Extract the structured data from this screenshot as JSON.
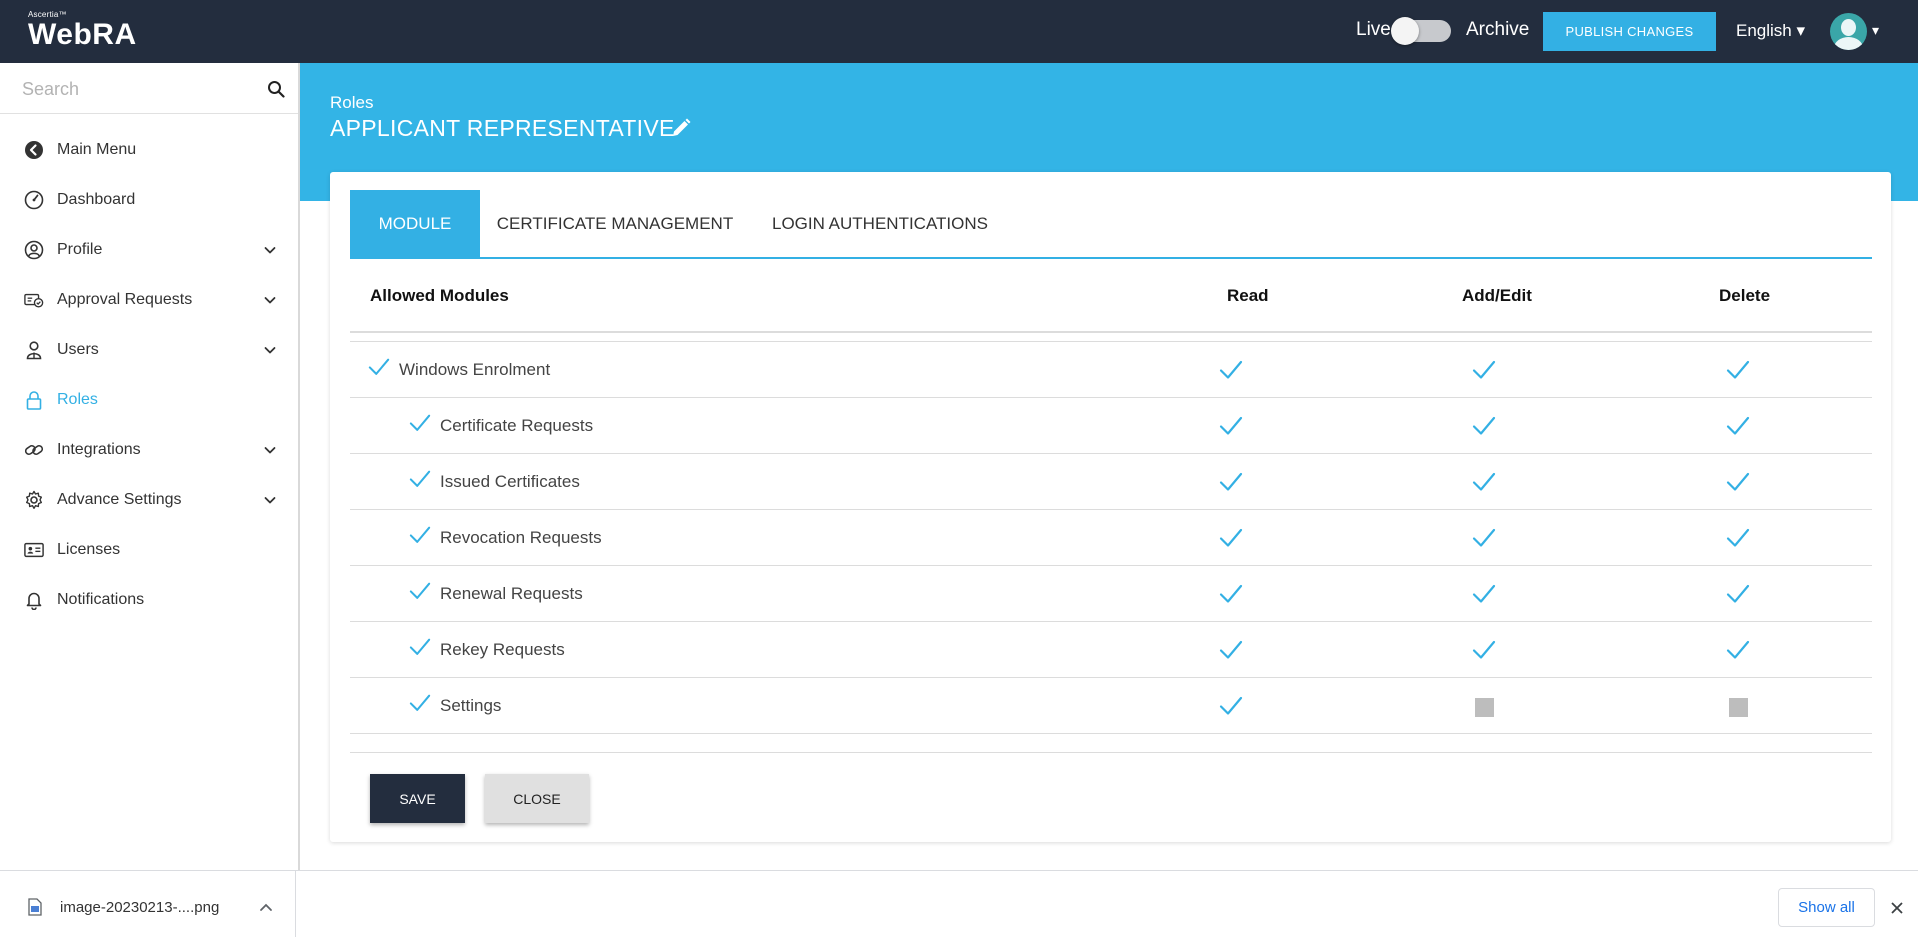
{
  "header": {
    "brand_small": "Ascertia™",
    "brand_main": "WebRA",
    "live_label": "Live",
    "archive_label": "Archive",
    "publish_label": "PUBLISH CHANGES",
    "language": "English ▾",
    "avatar_caret": "▾"
  },
  "sidebar": {
    "search_placeholder": "Search",
    "items": [
      {
        "label": "Main Menu",
        "icon": "back-circle-icon"
      },
      {
        "label": "Dashboard",
        "icon": "gauge-icon"
      },
      {
        "label": "Profile",
        "icon": "user-circle-icon",
        "expandable": true
      },
      {
        "label": "Approval Requests",
        "icon": "approval-icon",
        "expandable": true
      },
      {
        "label": "Users",
        "icon": "users-icon",
        "expandable": true
      },
      {
        "label": "Roles",
        "icon": "lock-icon",
        "active": true
      },
      {
        "label": "Integrations",
        "icon": "link-icon",
        "expandable": true
      },
      {
        "label": "Advance Settings",
        "icon": "gear-icon",
        "expandable": true
      },
      {
        "label": "Licenses",
        "icon": "id-card-icon"
      },
      {
        "label": "Notifications",
        "icon": "bell-icon"
      }
    ]
  },
  "banner": {
    "breadcrumb": "Roles",
    "title": "APPLICANT REPRESENTATIVE"
  },
  "tabs": [
    {
      "label": "MODULE",
      "active": true
    },
    {
      "label": "CERTIFICATE MANAGEMENT",
      "active": false
    },
    {
      "label": "LOGIN AUTHENTICATIONS",
      "active": false
    }
  ],
  "table": {
    "columns": [
      "Allowed Modules",
      "Read",
      "Add/Edit",
      "Delete"
    ],
    "rows": [
      {
        "label": "Windows Enrolment",
        "level": 0,
        "read": true,
        "add_edit": true,
        "delete": true
      },
      {
        "label": "Certificate Requests",
        "level": 1,
        "read": true,
        "add_edit": true,
        "delete": true
      },
      {
        "label": "Issued Certificates",
        "level": 1,
        "read": true,
        "add_edit": true,
        "delete": true
      },
      {
        "label": "Revocation Requests",
        "level": 1,
        "read": true,
        "add_edit": true,
        "delete": true
      },
      {
        "label": "Renewal Requests",
        "level": 1,
        "read": true,
        "add_edit": true,
        "delete": true
      },
      {
        "label": "Rekey Requests",
        "level": 1,
        "read": true,
        "add_edit": true,
        "delete": true
      },
      {
        "label": "Settings",
        "level": 1,
        "read": true,
        "add_edit": false,
        "delete": false
      }
    ]
  },
  "actions": {
    "save_label": "SAVE",
    "close_label": "CLOSE"
  },
  "downloads": {
    "file_name": "image-20230213-....png",
    "show_all_label": "Show all"
  },
  "colors": {
    "accent": "#33b0e4",
    "header_bg": "#232d3e",
    "check": "#33b0e4",
    "disabled_box": "#bdbdbd"
  }
}
